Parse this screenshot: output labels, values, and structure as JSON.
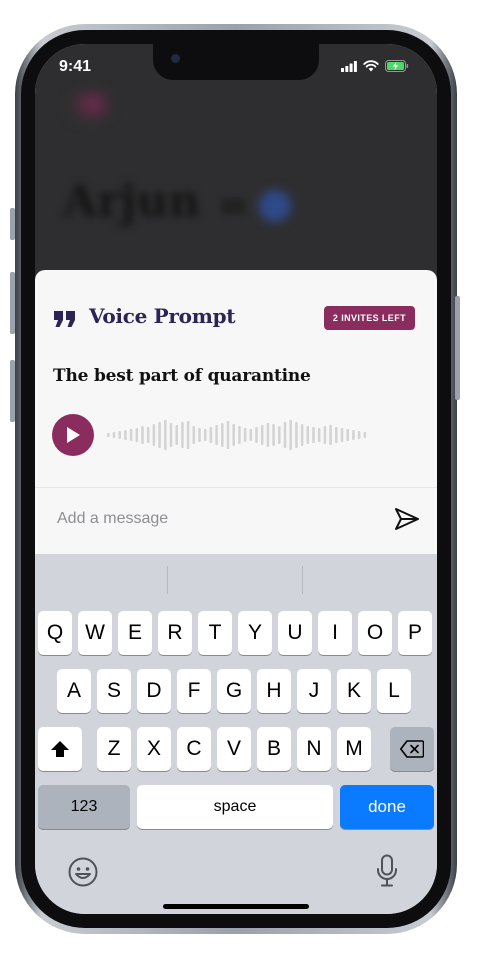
{
  "status_bar": {
    "time": "9:41"
  },
  "background_profile": {
    "name": "Arjun"
  },
  "prompt_card": {
    "title": "Voice Prompt",
    "invites_badge": "2 INVITES LEFT",
    "question": "The best part of quarantine",
    "message_placeholder": "Add a message"
  },
  "keyboard": {
    "row1": [
      "Q",
      "W",
      "E",
      "R",
      "T",
      "Y",
      "U",
      "I",
      "O",
      "P"
    ],
    "row2": [
      "A",
      "S",
      "D",
      "F",
      "G",
      "H",
      "J",
      "K",
      "L"
    ],
    "row3": [
      "Z",
      "X",
      "C",
      "V",
      "B",
      "N",
      "M"
    ],
    "numbers_label": "123",
    "space_label": "space",
    "done_label": "done"
  },
  "colors": {
    "accent": "#8b2c5e",
    "title": "#2c2454",
    "done_key": "#0a7aff"
  },
  "icons": [
    "quote-icon",
    "play-icon",
    "send-icon",
    "shift-icon",
    "backspace-icon",
    "emoji-icon",
    "microphone-icon",
    "signal-icon",
    "wifi-icon",
    "battery-icon"
  ]
}
